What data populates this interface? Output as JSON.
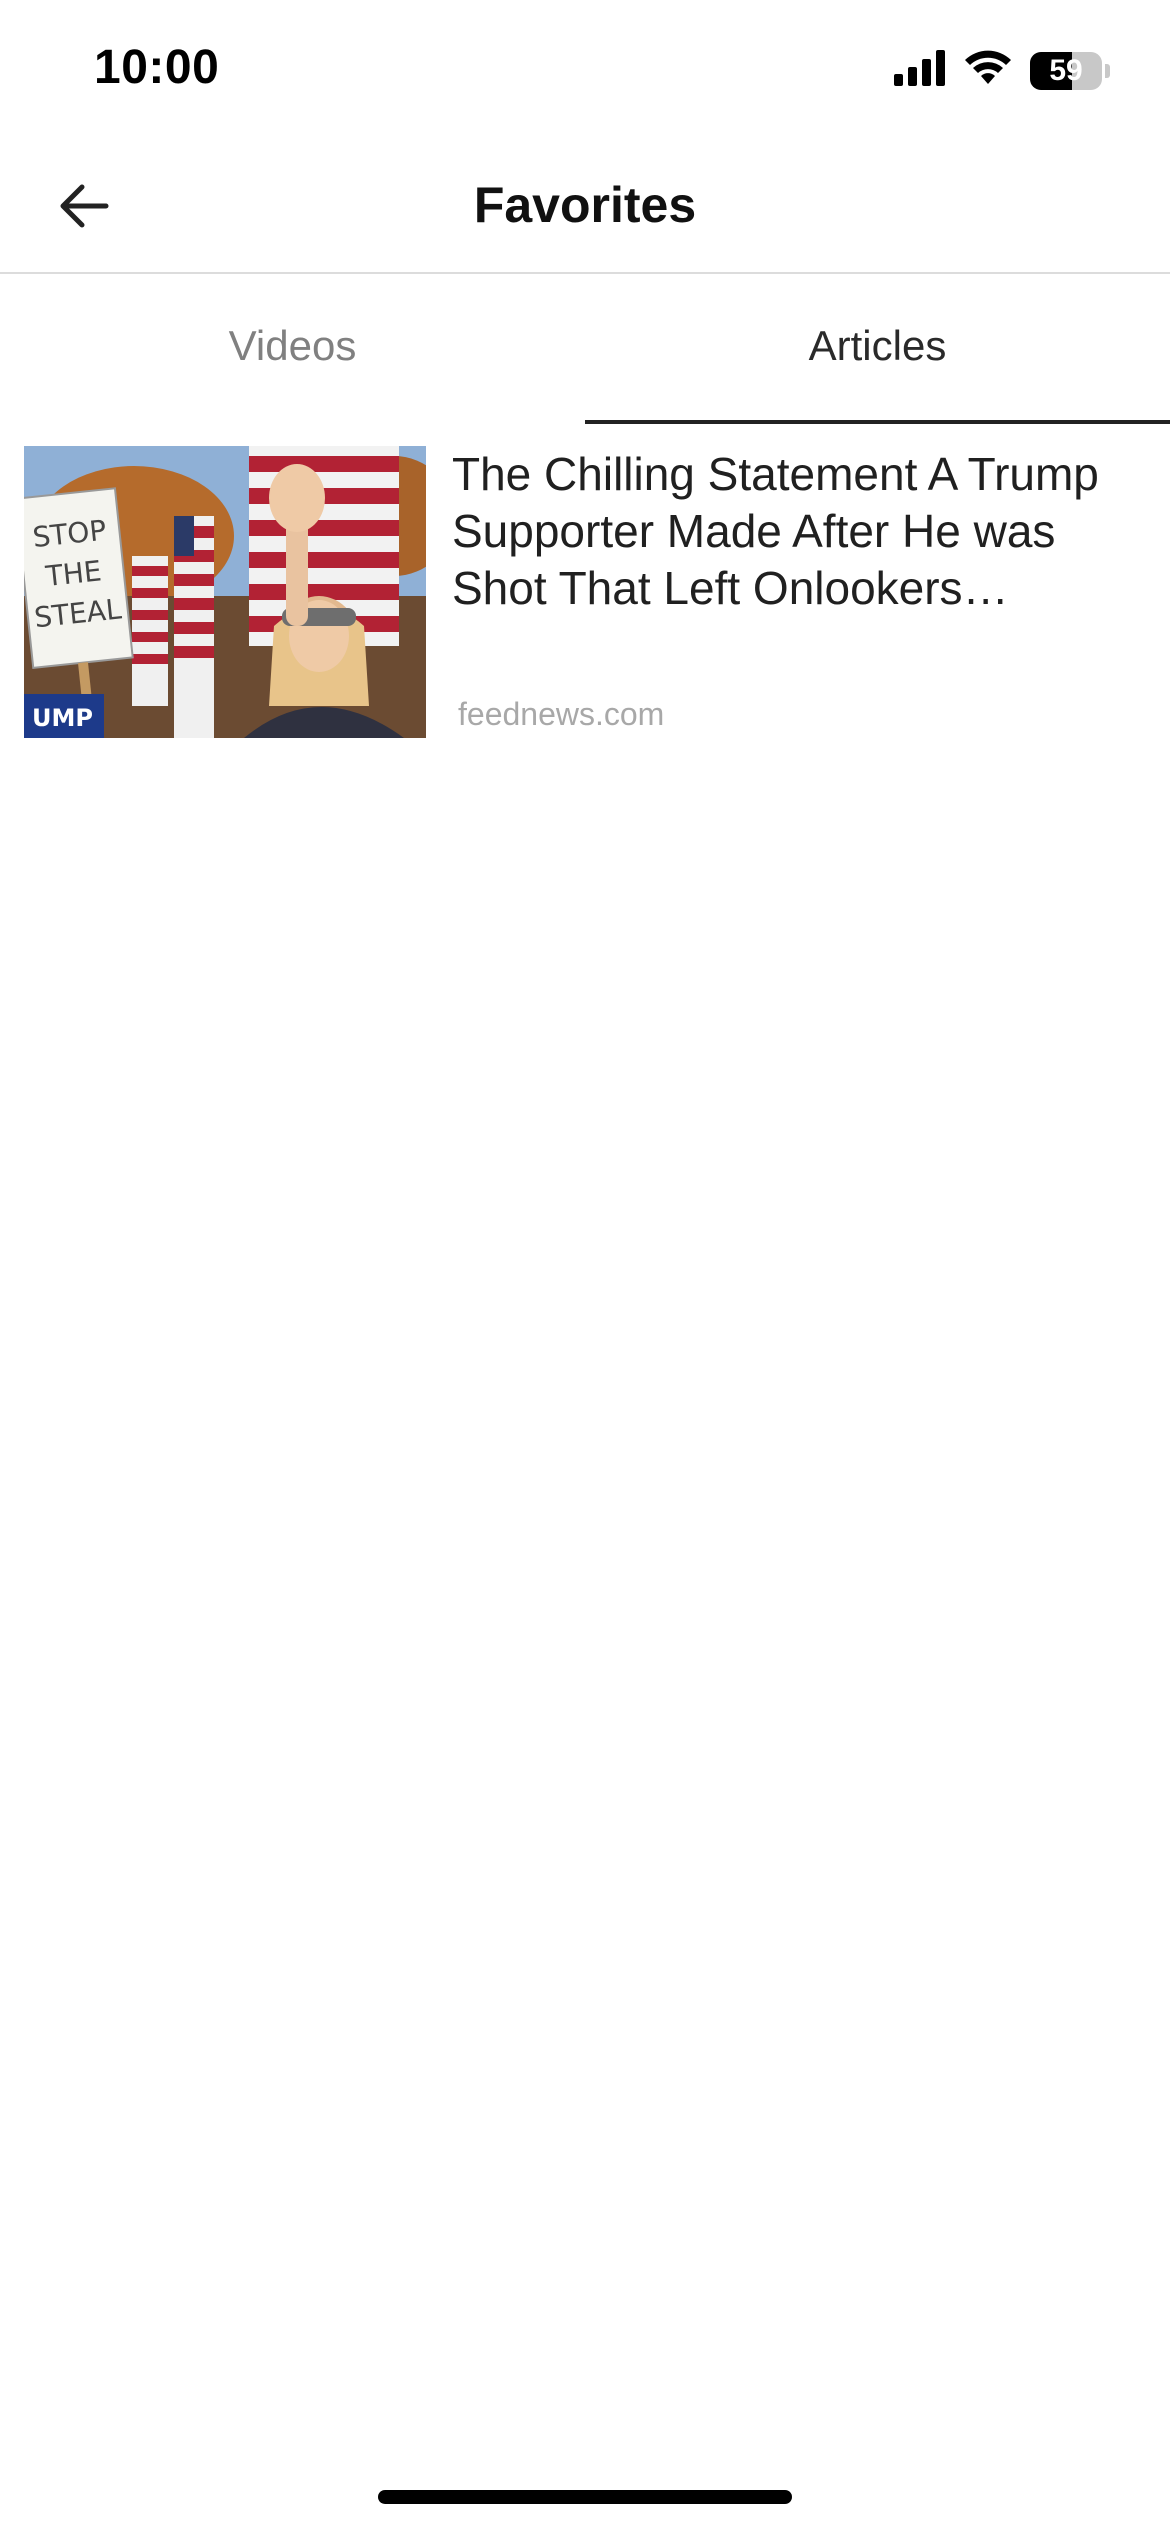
{
  "status_bar": {
    "time": "10:00",
    "battery_level": "59",
    "battery_fraction": 0.59,
    "icons": [
      "cellular-signal-icon",
      "wifi-icon",
      "battery-icon"
    ]
  },
  "header": {
    "title": "Favorites",
    "back_icon": "arrow-left-icon"
  },
  "tabs": [
    {
      "label": "Videos",
      "active": false
    },
    {
      "label": "Articles",
      "active": true
    }
  ],
  "articles": [
    {
      "title": "The Chilling Statement A Trump Supporter Made After He was Shot That Left Onlookers Stunned",
      "source": "feednews.com",
      "thumbnail": {
        "description_icon": "protest-photo-thumbnail",
        "sign_text": "STOP THE STEAL"
      }
    }
  ],
  "colors": {
    "active_tab_text": "#2a2a2a",
    "inactive_tab_text": "#808080",
    "source_text": "#a8a8a8",
    "divider": "#dcdcdc"
  }
}
